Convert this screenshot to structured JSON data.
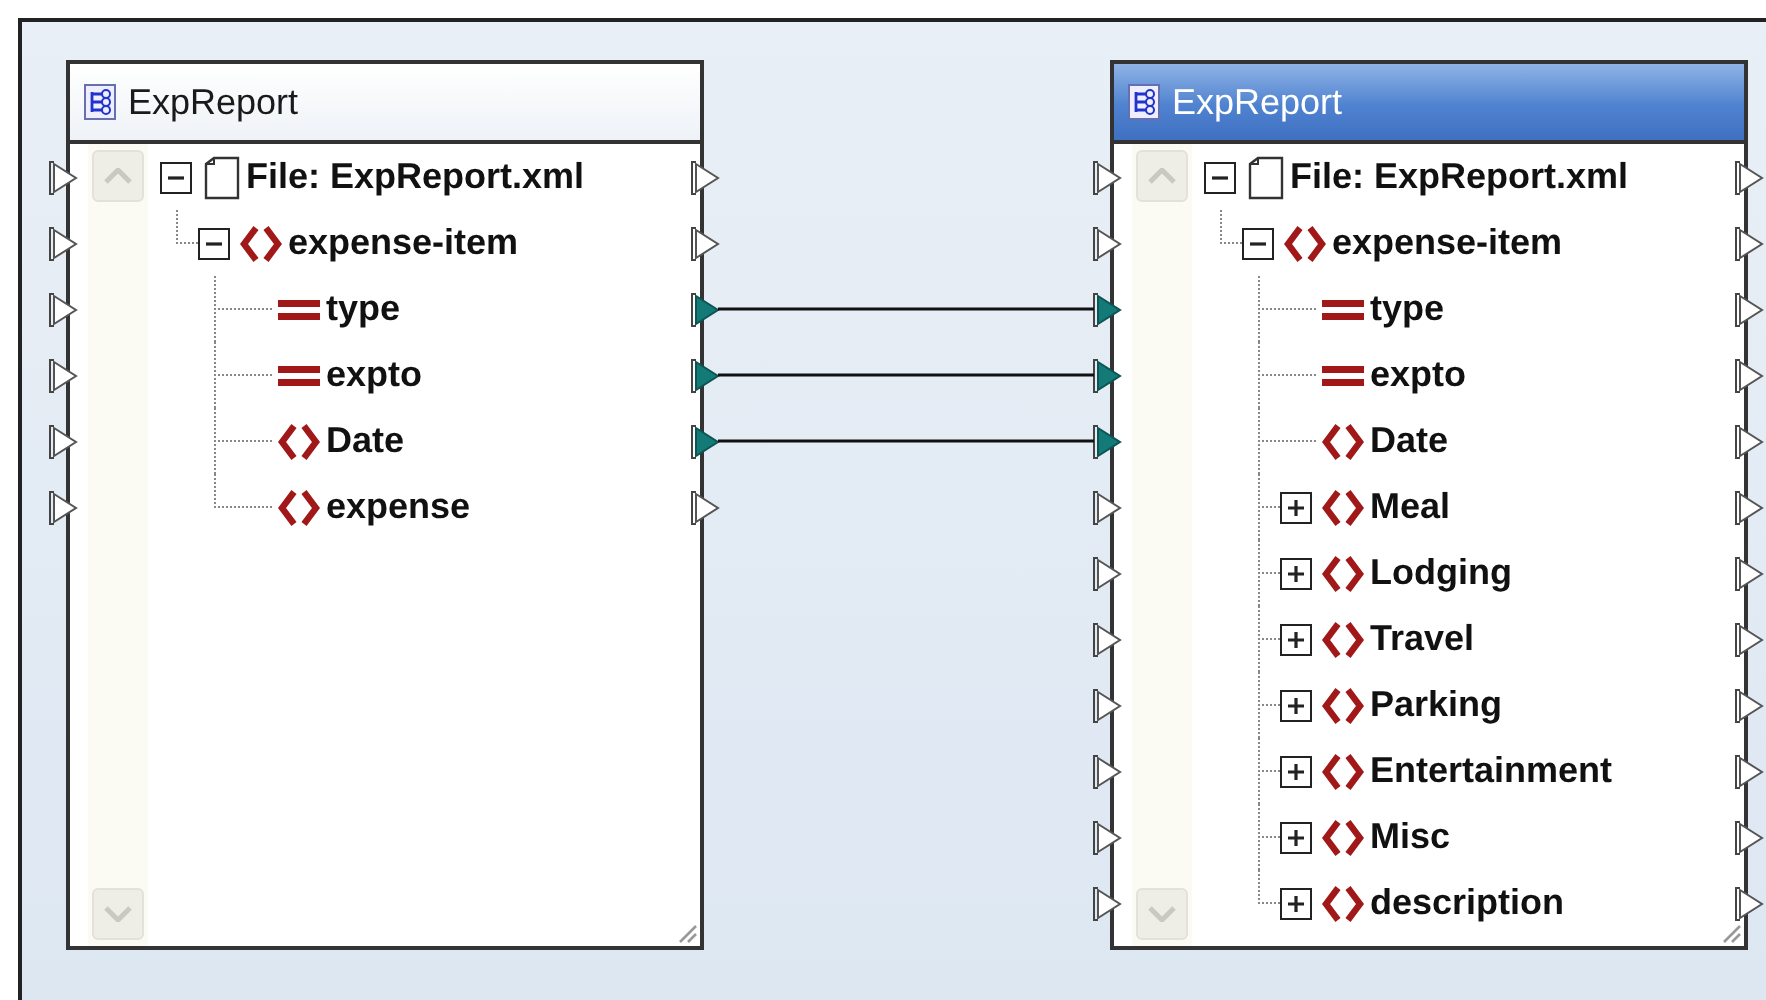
{
  "components": [
    {
      "title": "ExpReport",
      "selected": false,
      "kind": "source",
      "tree": [
        {
          "kind": "file",
          "label": "File: ExpReport.xml",
          "expanded": true,
          "mapped": false,
          "children": [
            {
              "kind": "element",
              "label": "expense-item",
              "expanded": true,
              "mapped": false,
              "children": [
                {
                  "kind": "attribute",
                  "label": "type",
                  "mapped": true
                },
                {
                  "kind": "attribute",
                  "label": "expto",
                  "mapped": true
                },
                {
                  "kind": "element",
                  "label": "Date",
                  "mapped": true
                },
                {
                  "kind": "element",
                  "label": "expense",
                  "mapped": false
                }
              ]
            }
          ]
        }
      ]
    },
    {
      "title": "ExpReport",
      "selected": true,
      "kind": "target",
      "tree": [
        {
          "kind": "file",
          "label": "File: ExpReport.xml",
          "expanded": true,
          "mapped": false,
          "children": [
            {
              "kind": "element",
              "label": "expense-item",
              "expanded": true,
              "mapped": false,
              "children": [
                {
                  "kind": "attribute",
                  "label": "type",
                  "mapped": true
                },
                {
                  "kind": "attribute",
                  "label": "expto",
                  "mapped": true
                },
                {
                  "kind": "element",
                  "label": "Date",
                  "mapped": true
                },
                {
                  "kind": "element",
                  "label": "Meal",
                  "expanded": false,
                  "mapped": false
                },
                {
                  "kind": "element",
                  "label": "Lodging",
                  "expanded": false,
                  "mapped": false
                },
                {
                  "kind": "element",
                  "label": "Travel",
                  "expanded": false,
                  "mapped": false
                },
                {
                  "kind": "element",
                  "label": "Parking",
                  "expanded": false,
                  "mapped": false
                },
                {
                  "kind": "element",
                  "label": "Entertainment",
                  "expanded": false,
                  "mapped": false
                },
                {
                  "kind": "element",
                  "label": "Misc",
                  "expanded": false,
                  "mapped": false
                },
                {
                  "kind": "element",
                  "label": "description",
                  "expanded": false,
                  "mapped": false
                }
              ]
            }
          ]
        }
      ]
    }
  ]
}
